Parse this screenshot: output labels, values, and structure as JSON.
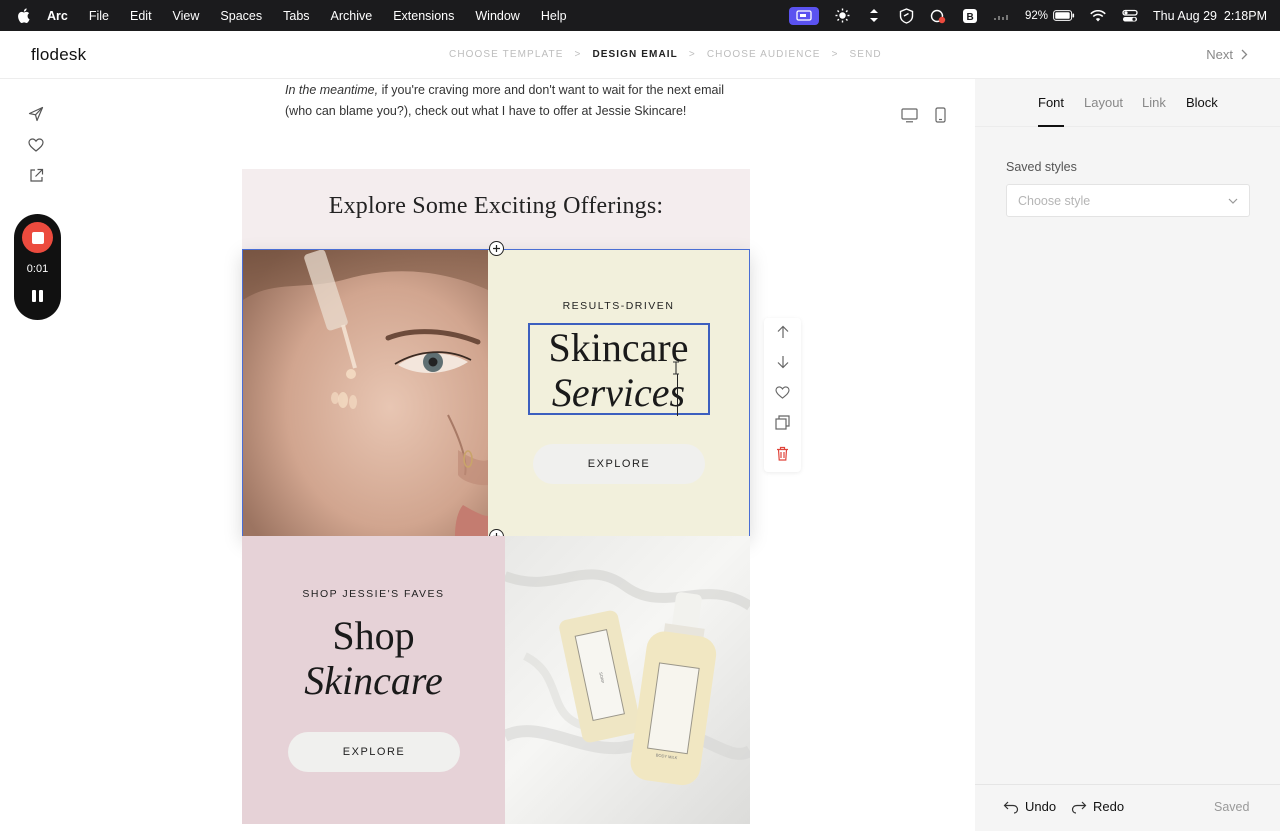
{
  "menubar": {
    "app_name": "Arc",
    "menus": [
      "File",
      "Edit",
      "View",
      "Spaces",
      "Tabs",
      "Archive",
      "Extensions",
      "Window",
      "Help"
    ],
    "battery": "92%",
    "datetime": "Thu Aug 29  2:18PM"
  },
  "header": {
    "logo": "flodesk",
    "steps": [
      "CHOOSE TEMPLATE",
      "DESIGN EMAIL",
      "CHOOSE AUDIENCE",
      "SEND"
    ],
    "active_step_index": 1,
    "step_separator": ">",
    "next_label": "Next"
  },
  "recorder": {
    "time": "0:01"
  },
  "email": {
    "intro_italic": "In the meantime,",
    "intro_rest": " if you're craving more and don't want to wait for the next email (who can blame you?), check out what I have to offer at Jessie Skincare!",
    "section_title": "Explore Some Exciting Offerings:",
    "block1": {
      "eyebrow": "RESULTS-DRIVEN",
      "heading_line1": "Skincare",
      "heading_line2": "Services",
      "button": "EXPLORE"
    },
    "block2": {
      "eyebrow": "SHOP JESSIE'S FAVES",
      "heading_line1": "Shop",
      "heading_line2": "Skincare",
      "button": "EXPLORE"
    },
    "product_labels": [
      "SOAP",
      "BODY MILK"
    ]
  },
  "right_panel": {
    "tabs": [
      "Font",
      "Layout",
      "Link",
      "Block"
    ],
    "active_tab_index": 0,
    "saved_styles_label": "Saved styles",
    "style_select_placeholder": "Choose style",
    "undo_label": "Undo",
    "redo_label": "Redo",
    "save_status": "Saved"
  },
  "colors": {
    "accent_selection": "#4a6ed4",
    "recorder_red": "#ec4b3e",
    "meeting_purple": "#5a52f0",
    "section_pink": "#f4edee",
    "cream_panel": "#f2f0dc",
    "pink_panel": "#e6d2d7",
    "delete_red": "#e0443a"
  }
}
